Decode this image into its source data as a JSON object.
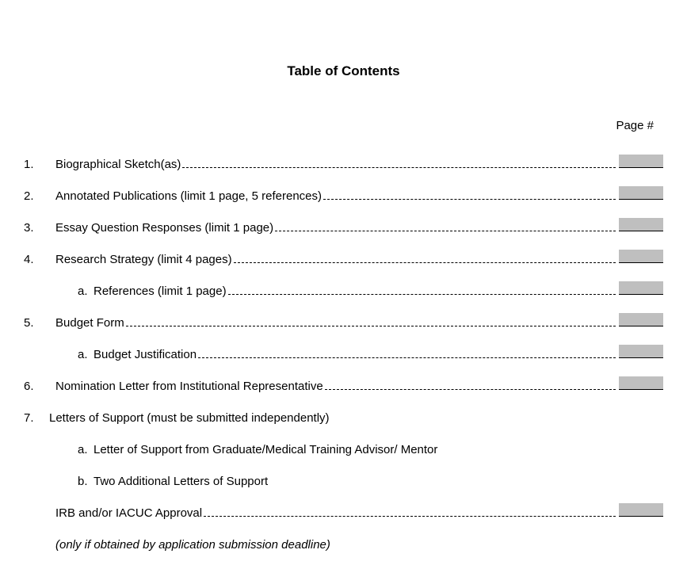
{
  "title": "Table of Contents",
  "page_header": "Page #",
  "items": {
    "i1": {
      "num": "1.",
      "label": "Biographical Sketch(as)"
    },
    "i2": {
      "num": "2.",
      "label": "Annotated Publications (limit 1 page, 5 references)"
    },
    "i3": {
      "num": "3.",
      "label": "Essay Question Responses (limit 1 page)"
    },
    "i4": {
      "num": "4.",
      "label": "Research Strategy (limit 4 pages)"
    },
    "i4a": {
      "letter": "a.",
      "label": "References (limit 1 page)"
    },
    "i5": {
      "num": "5.",
      "label": "Budget Form"
    },
    "i5a": {
      "letter": "a.",
      "label": "Budget Justification"
    },
    "i6": {
      "num": "6.",
      "label": "Nomination Letter from Institutional Representative"
    },
    "i7": {
      "num": "7.",
      "label": "Letters of Support (must be submitted independently)"
    },
    "i7a": {
      "letter": "a.",
      "label": "Letter of Support from Graduate/Medical Training Advisor/ Mentor"
    },
    "i7b": {
      "letter": "b.",
      "label": "Two Additional Letters of Support"
    },
    "irb": {
      "label": "IRB and/or IACUC Approval"
    },
    "irb_note": {
      "label": "(only if obtained by application submission deadline)"
    }
  }
}
